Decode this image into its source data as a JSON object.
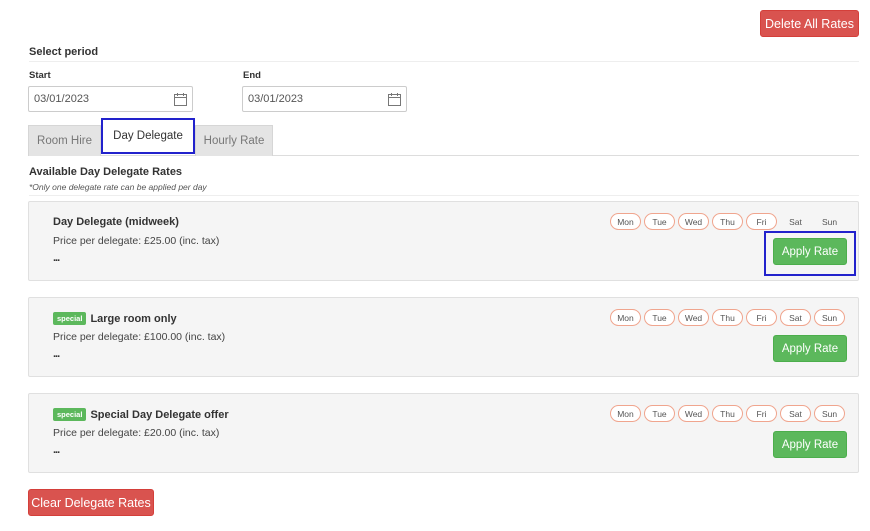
{
  "actions": {
    "delete_all": "Delete All Rates",
    "clear_delegate": "Clear Delegate Rates"
  },
  "period": {
    "heading": "Select period",
    "start_label": "Start",
    "start_value": "03/01/2023",
    "end_label": "End",
    "end_value": "03/01/2023"
  },
  "tabs": [
    {
      "label": "Room Hire",
      "active": false
    },
    {
      "label": "Day Delegate",
      "active": true
    },
    {
      "label": "Hourly Rate",
      "active": false
    }
  ],
  "rates_section": {
    "title": "Available Day Delegate Rates",
    "note": "*Only one delegate rate can be applied per day"
  },
  "rates": [
    {
      "badge": "",
      "name": "Day Delegate (midweek)",
      "price": "Price per delegate: £25.00 (inc. tax)",
      "more": "...",
      "days": [
        {
          "label": "Mon",
          "available": true
        },
        {
          "label": "Tue",
          "available": true
        },
        {
          "label": "Wed",
          "available": true
        },
        {
          "label": "Thu",
          "available": true
        },
        {
          "label": "Fri",
          "available": true
        },
        {
          "label": "Sat",
          "available": false
        },
        {
          "label": "Sun",
          "available": false
        }
      ],
      "apply_label": "Apply Rate"
    },
    {
      "badge": "special",
      "name": "Large room only",
      "price": "Price per delegate: £100.00 (inc. tax)",
      "more": "...",
      "days": [
        {
          "label": "Mon",
          "available": true
        },
        {
          "label": "Tue",
          "available": true
        },
        {
          "label": "Wed",
          "available": true
        },
        {
          "label": "Thu",
          "available": true
        },
        {
          "label": "Fri",
          "available": true
        },
        {
          "label": "Sat",
          "available": true
        },
        {
          "label": "Sun",
          "available": true
        }
      ],
      "apply_label": "Apply Rate"
    },
    {
      "badge": "special",
      "name": "Special Day Delegate offer",
      "price": "Price per delegate: £20.00 (inc. tax)",
      "more": "...",
      "days": [
        {
          "label": "Mon",
          "available": true
        },
        {
          "label": "Tue",
          "available": true
        },
        {
          "label": "Wed",
          "available": true
        },
        {
          "label": "Thu",
          "available": true
        },
        {
          "label": "Fri",
          "available": true
        },
        {
          "label": "Sat",
          "available": true
        },
        {
          "label": "Sun",
          "available": true
        }
      ],
      "apply_label": "Apply Rate"
    }
  ],
  "colors": {
    "danger": "#d9534f",
    "success": "#5cb85c",
    "highlight": "#2222cc",
    "day_border": "#f0a58e"
  }
}
